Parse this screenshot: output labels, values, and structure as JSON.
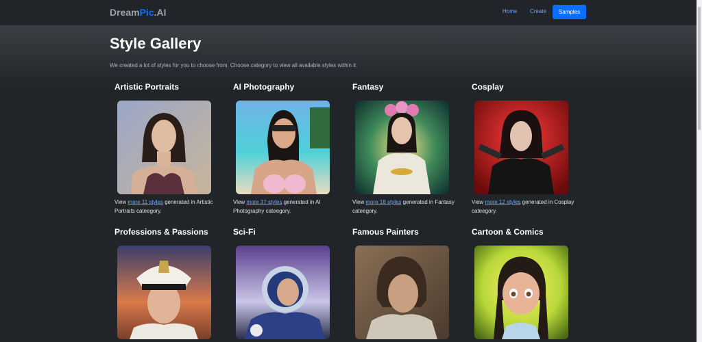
{
  "nav": {
    "brand_part1": "Dream",
    "brand_part2": "Pic",
    "brand_part3": ".AI",
    "home": "Home",
    "create": "Create",
    "samples": "Samples"
  },
  "page": {
    "title": "Style Gallery",
    "description": "We created a lot of styles for you to choose from. Choose category to view all available styles within it."
  },
  "categories": [
    {
      "title": "Artistic Portraits",
      "pre": "View ",
      "link": "more 11 styles",
      "post": " generated in Artistic Portraits cateegory."
    },
    {
      "title": "AI Photography",
      "pre": "View ",
      "link": "more 37 styles",
      "post": " generated in AI Photography cateegory."
    },
    {
      "title": "Fantasy",
      "pre": "View ",
      "link": "more 18 styles",
      "post": " generated in Fantasy cateegory."
    },
    {
      "title": "Cosplay",
      "pre": "View ",
      "link": "more 12 styles",
      "post": " generated in Cosplay cateegory."
    },
    {
      "title": "Professions & Passions"
    },
    {
      "title": "Sci-Fi"
    },
    {
      "title": "Famous Painters"
    },
    {
      "title": "Cartoon & Comics"
    }
  ],
  "colors": {
    "background": "#212529",
    "primary": "#0d6efd",
    "link": "#6ea8fe"
  }
}
